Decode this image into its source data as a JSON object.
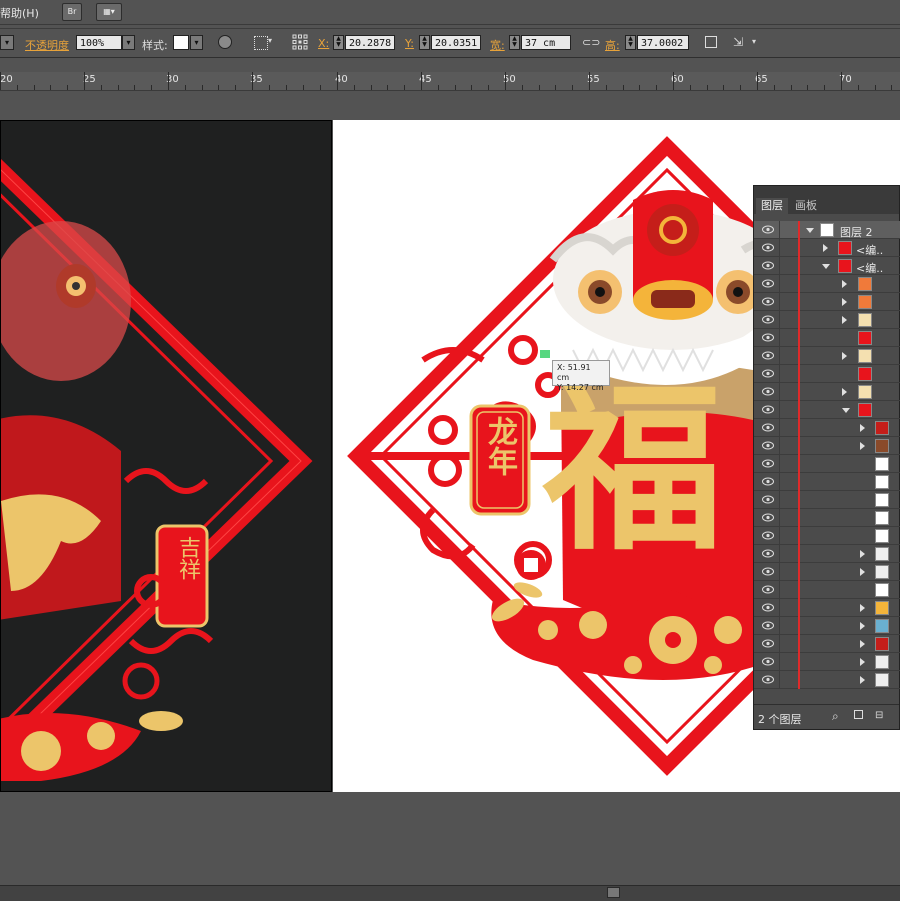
{
  "menu": {
    "help": "帮助(H)"
  },
  "controlbar": {
    "opacity_label": "不透明度",
    "opacity_value": "100%",
    "style_label": "样式:",
    "x_label": "X:",
    "x_value": "20.2878",
    "y_label": "Y:",
    "y_value": "20.0351",
    "width_label": "宽:",
    "width_value": "37 cm",
    "height_label": "高:",
    "height_value": "37.0002"
  },
  "ruler": {
    "ticks": [
      "20",
      "25",
      "30",
      "35",
      "40",
      "45",
      "50",
      "55",
      "60",
      "65",
      "70"
    ]
  },
  "canvas": {
    "tag_text": "龙年",
    "tag_text_outline": "吉祥",
    "fu_char": "福",
    "tooltip_x": "X: 51.91 cm",
    "tooltip_y": "Y: 14.27 cm",
    "colors": {
      "red": "#e8141c",
      "gold": "#ecc56a",
      "dark": "#1f2020"
    }
  },
  "layers_panel": {
    "tab_layers": "图层",
    "tab_artboards": "画板",
    "top_layer_name": "图层 2",
    "group_names": [
      "<编..",
      "<编.."
    ],
    "footer_count": "2 个图层",
    "icons": [
      "search-icon",
      "locate-object-icon",
      "make-clip-mask-icon"
    ]
  }
}
